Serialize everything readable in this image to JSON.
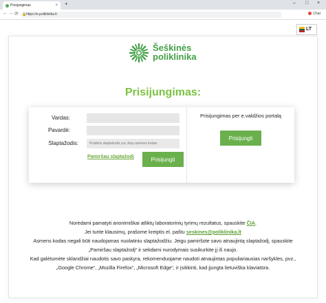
{
  "browser": {
    "tab_title": "Prisijungimas",
    "tab_close": "×",
    "new_tab": "+",
    "url": "https://e.poliklinika.lt",
    "chat_label": "Chat",
    "minimize": "–",
    "maximize": "□",
    "close": "×",
    "back": "←",
    "forward": "→",
    "reload": "⟳"
  },
  "language": {
    "code": "LT",
    "flag_colors": [
      "#fdb913",
      "#006a44",
      "#c1272d"
    ]
  },
  "brand": {
    "name_line1": "Šeškinės",
    "name_line2": "poliklinika",
    "color": "#43a047"
  },
  "login": {
    "title": "Prisijungimas:",
    "username_label": "Vardas:",
    "surname_label": "Pavardė:",
    "password_label": "Slaptažodis:",
    "password_placeholder": "Pradinis slaptažodis yra Jūsų asmens kodas",
    "forgot_link": "Pamiršau slaptažodį",
    "login_button": "Prisijungti"
  },
  "evaldzia": {
    "text": "Prisijungimas per e.valdžios portalą",
    "button": "Prisijungti"
  },
  "info": {
    "line1_text": "Norėdami pamatyti anonimiškai atliktų laboratorinių tyrimų rezultatus, spauskite",
    "line1_link": "ČIA",
    "line1_end": ".",
    "line2_text": "Jei turite klausimų, prašome kreiptis el. paštu",
    "line2_link": "seskines@poliklinika.lt",
    "line3": "Asmens kodas negali būti naudojamas nuolatiniu slaptažodžiu. Jeigu pamiršote savo atnaujintą slaptažodį, spauskite",
    "line4": "„Pamiršau slaptažodį“ ir sekdami nurodymais susikurkite jį iš naujo.",
    "line5": "Kad galėtumėte sklandžiai naudotis savo paskyra, rekomenduojame naudoti atnaujintas populiariausias naršykles, pvz.,",
    "line6": "„Google Chrome“, „Mozilla Firefox“, „Microsoft Edge“, ir įsitikinti, kad įjungta lietuviška klaviatūra."
  },
  "colors": {
    "accent": "#6ab04c",
    "title": "#7cc242"
  }
}
